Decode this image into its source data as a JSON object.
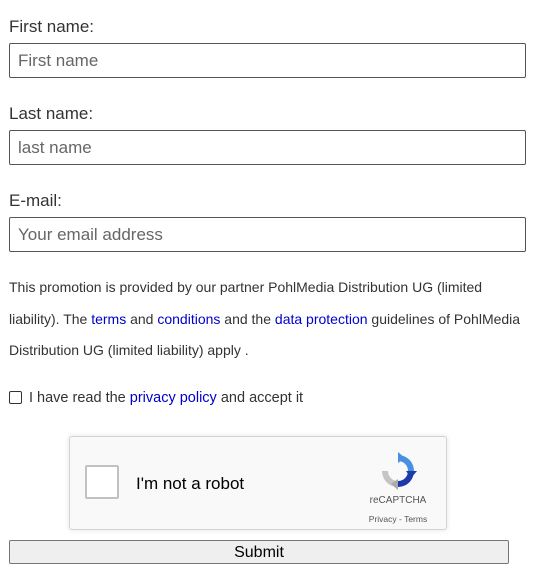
{
  "form": {
    "first_name": {
      "label": "First name:",
      "value": "",
      "placeholder": "First name"
    },
    "last_name": {
      "label": "Last name:",
      "value": "",
      "placeholder": "last name"
    },
    "email": {
      "label": "E-mail:",
      "value": "",
      "placeholder": "Your email address"
    },
    "notice": {
      "part1": "This promotion is provided by our partner PohlMedia Distribution UG (limited liability). The ",
      "terms_link": "terms",
      "part2": " and ",
      "conditions_link": "conditions",
      "part3": " and the ",
      "data_protection_link": "data protection",
      "part4": " guidelines of PohlMedia Distribution UG (limited liability) apply ."
    },
    "consent": {
      "checked": false,
      "prefix": "I have read the ",
      "privacy_link": "privacy policy",
      "suffix": " and accept it"
    },
    "recaptcha": {
      "label": "I'm not a robot",
      "brand": "reCAPTCHA",
      "privacy_link": "Privacy",
      "separator": " - ",
      "terms_link": "Terms",
      "logo_icon": "recaptcha-logo-icon"
    },
    "submit_label": "Submit"
  }
}
